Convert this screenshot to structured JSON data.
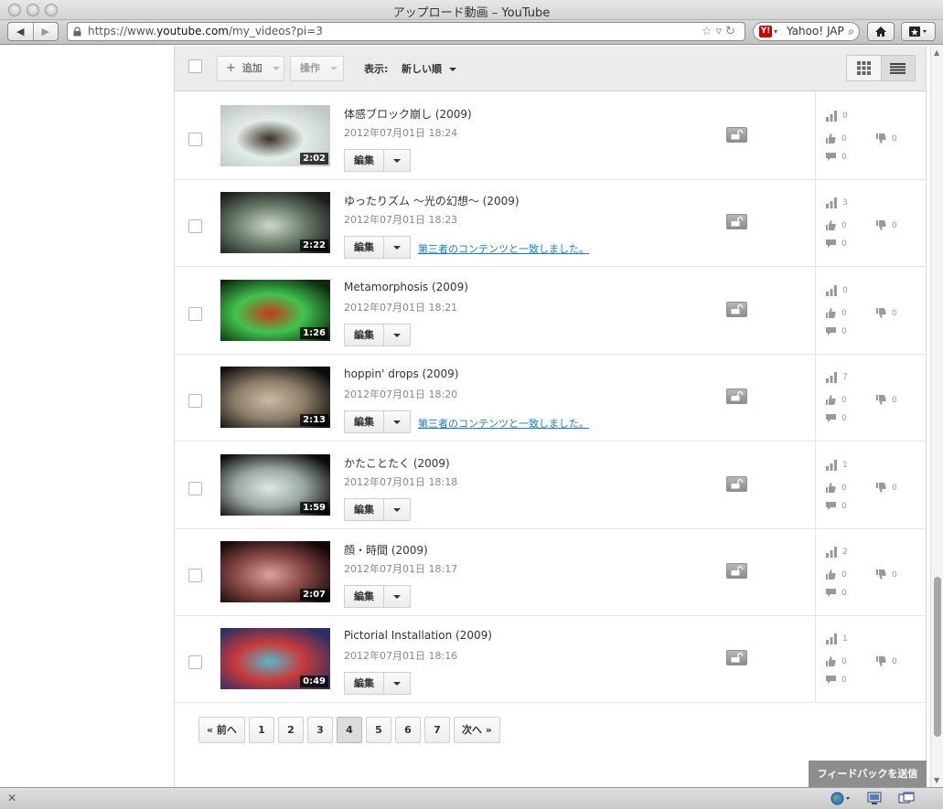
{
  "window": {
    "title": "アップロード動画 – YouTube"
  },
  "browser": {
    "url_prefix": "https://www.",
    "url_domain": "youtube.com",
    "url_path": "/my_videos?pi=3",
    "search_engine_label": "Yahoo! JAP",
    "nav_back": "◀",
    "nav_forward": "▶"
  },
  "action_bar": {
    "add_label": "追加",
    "actions_label": "操作",
    "display_label": "表示:",
    "sort_value": "新しい順"
  },
  "videos": [
    {
      "title": "体感ブロック崩し (2009)",
      "date": "2012年07月01日 18:24",
      "duration": "2:02",
      "views": "0",
      "likes": "0",
      "dislikes": "0",
      "comments": "0",
      "match_notice": "",
      "thumb_colors": [
        "#bfc8c6",
        "#e4ece8",
        "#3a3028"
      ]
    },
    {
      "title": "ゆったりズム 〜光の幻想〜 (2009)",
      "date": "2012年07月01日 18:23",
      "duration": "2:22",
      "views": "3",
      "likes": "0",
      "dislikes": "0",
      "comments": "0",
      "match_notice": "第三者のコンテンツと一致しました。",
      "thumb_colors": [
        "#1a1a1a",
        "#6d7f6f",
        "#d0d8cc"
      ]
    },
    {
      "title": "Metamorphosis (2009)",
      "date": "2012年07月01日 18:21",
      "duration": "1:26",
      "views": "0",
      "likes": "0",
      "dislikes": "0",
      "comments": "0",
      "match_notice": "",
      "thumb_colors": [
        "#0e2a0e",
        "#3fc44f",
        "#c9381c"
      ]
    },
    {
      "title": "hoppin' drops (2009)",
      "date": "2012年07月01日 18:20",
      "duration": "2:13",
      "views": "7",
      "likes": "0",
      "dislikes": "0",
      "comments": "0",
      "match_notice": "第三者のコンテンツと一致しました。",
      "thumb_colors": [
        "#0c0c0c",
        "#8d7f6a",
        "#c9bca4"
      ]
    },
    {
      "title": "かたことたく (2009)",
      "date": "2012年07月01日 18:18",
      "duration": "1:59",
      "views": "1",
      "likes": "0",
      "dislikes": "0",
      "comments": "0",
      "match_notice": "",
      "thumb_colors": [
        "#0a0a0a",
        "#9ba7a5",
        "#dfe7e6"
      ]
    },
    {
      "title": "顔・時間 (2009)",
      "date": "2012年07月01日 18:17",
      "duration": "2:07",
      "views": "2",
      "likes": "0",
      "dislikes": "0",
      "comments": "0",
      "match_notice": "",
      "thumb_colors": [
        "#120707",
        "#8b4a48",
        "#d9a39c"
      ]
    },
    {
      "title": "Pictorial Installation (2009)",
      "date": "2012年07月01日 18:16",
      "duration": "0:49",
      "views": "1",
      "likes": "0",
      "dislikes": "0",
      "comments": "0",
      "match_notice": "",
      "thumb_colors": [
        "#2a2f66",
        "#c83a3a",
        "#58b7c8"
      ]
    }
  ],
  "row_common": {
    "edit_label": "編集"
  },
  "pagination": {
    "prev_label": "« 前へ",
    "next_label": "次へ »",
    "pages": [
      "1",
      "2",
      "3",
      "4",
      "5",
      "6",
      "7"
    ],
    "current_page": "4"
  },
  "feedback_label": "フィードバックを送信",
  "colors": {
    "link": "#167ac6",
    "actionbar_bg": "#ececec",
    "feedback_bg": "#8e8e8e"
  }
}
